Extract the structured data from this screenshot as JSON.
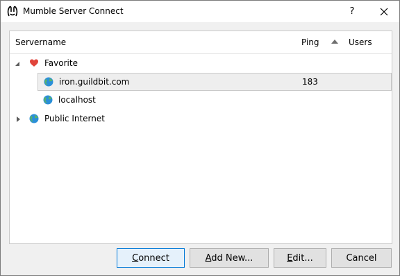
{
  "window": {
    "title": "Mumble Server Connect",
    "help_label": "?",
    "close_icon": "close-icon",
    "app_icon": "mumble-logo-icon"
  },
  "table": {
    "columns": {
      "servername": "Servername",
      "ping": "Ping",
      "users": "Users"
    },
    "sort_column": "Ping",
    "sort_order": "ascending"
  },
  "tree": {
    "favorite": {
      "label": "Favorite",
      "icon": "heart-icon",
      "expanded": true,
      "servers": [
        {
          "name": "iron.guildbit.com",
          "ping": "183",
          "users": "",
          "selected": true,
          "icon": "globe-icon"
        },
        {
          "name": "localhost",
          "ping": "",
          "users": "",
          "selected": false,
          "icon": "globe-icon"
        }
      ]
    },
    "public_internet": {
      "label": "Public Internet",
      "icon": "globe-icon",
      "expanded": false
    }
  },
  "buttons": {
    "connect": {
      "pre": "",
      "mnemonic": "C",
      "post": "onnect"
    },
    "add_new": {
      "pre": "",
      "mnemonic": "A",
      "post": "dd New..."
    },
    "edit": {
      "pre": "",
      "mnemonic": "E",
      "post": "dit..."
    },
    "cancel": {
      "label": "Cancel"
    }
  },
  "colors": {
    "accent": "#0078d7",
    "heart": "#e0443b",
    "globe_sea": "#2a8fd8",
    "globe_land": "#58b368",
    "selection_bg": "#eeeeee"
  }
}
